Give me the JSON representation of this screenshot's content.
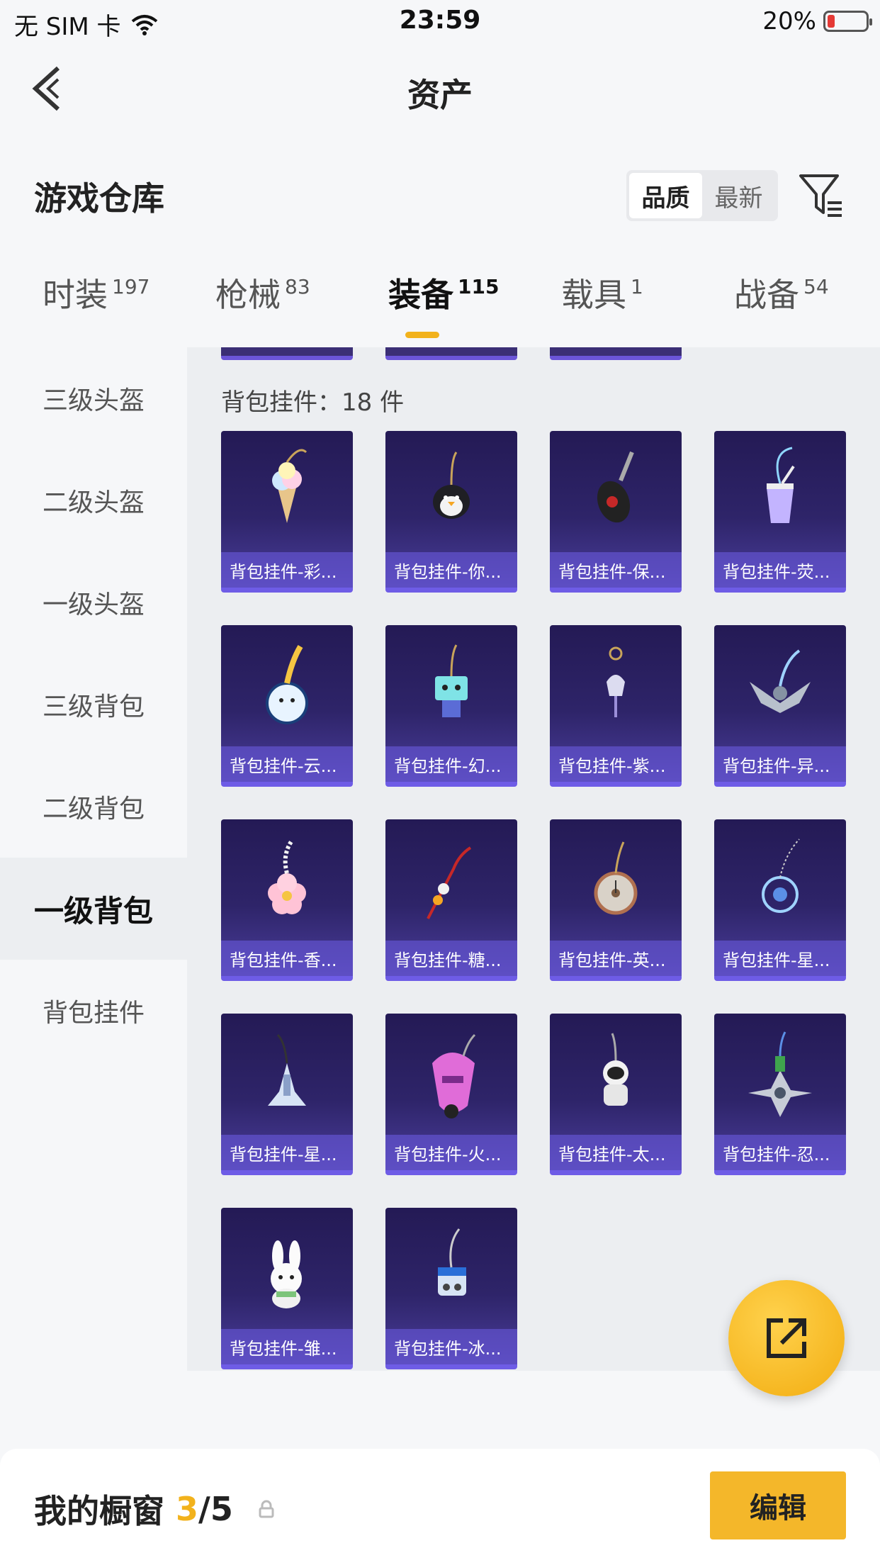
{
  "status_bar": {
    "carrier": "无 SIM 卡",
    "time": "23:59",
    "battery": "20%"
  },
  "nav": {
    "title": "资产"
  },
  "warehouse": {
    "title": "游戏仓库",
    "sort_options": [
      "品质",
      "最新"
    ],
    "sort_active": 0
  },
  "tabs": [
    {
      "label": "时装",
      "count": "197"
    },
    {
      "label": "枪械",
      "count": "83"
    },
    {
      "label": "装备",
      "count": "115"
    },
    {
      "label": "载具",
      "count": "1"
    },
    {
      "label": "战备",
      "count": "54"
    }
  ],
  "sidebar": {
    "items": [
      "三级头盔",
      "二级头盔",
      "一级头盔",
      "三级背包",
      "二级背包",
      "一级背包",
      "背包挂件"
    ],
    "active": 5
  },
  "section": {
    "label": "背包挂件：18 件"
  },
  "items": [
    {
      "label": "背包挂件-彩...",
      "icon": "ice-cream-charm-icon"
    },
    {
      "label": "背包挂件-你...",
      "icon": "penguin-charm-icon"
    },
    {
      "label": "背包挂件-保...",
      "icon": "car-key-charm-icon"
    },
    {
      "label": "背包挂件-荧...",
      "icon": "drink-cup-charm-icon"
    },
    {
      "label": "背包挂件-云...",
      "icon": "cloud-mirror-charm-icon"
    },
    {
      "label": "背包挂件-幻...",
      "icon": "robot-charm-icon"
    },
    {
      "label": "背包挂件-紫...",
      "icon": "bell-flower-charm-icon"
    },
    {
      "label": "背包挂件-异...",
      "icon": "wing-emblem-charm-icon"
    },
    {
      "label": "背包挂件-香...",
      "icon": "flower-charm-icon"
    },
    {
      "label": "背包挂件-糖...",
      "icon": "candy-tassel-charm-icon"
    },
    {
      "label": "背包挂件-英...",
      "icon": "pocket-watch-charm-icon"
    },
    {
      "label": "背包挂件-星...",
      "icon": "dreamcatcher-charm-icon"
    },
    {
      "label": "背包挂件-星...",
      "icon": "space-shuttle-charm-icon"
    },
    {
      "label": "背包挂件-火...",
      "icon": "rocket-charm-icon"
    },
    {
      "label": "背包挂件-太...",
      "icon": "astronaut-charm-icon"
    },
    {
      "label": "背包挂件-忍...",
      "icon": "shuriken-charm-icon"
    },
    {
      "label": "背包挂件-雏...",
      "icon": "bunny-charm-icon"
    },
    {
      "label": "背包挂件-冰...",
      "icon": "capsule-charm-icon"
    }
  ],
  "bottom_bar": {
    "title": "我的橱窗",
    "used": "3",
    "total": "/5",
    "edit_label": "编辑"
  },
  "colors": {
    "accent": "#f2b21c",
    "card_bg": "#2e2469",
    "card_border": "#6e5ce6"
  }
}
